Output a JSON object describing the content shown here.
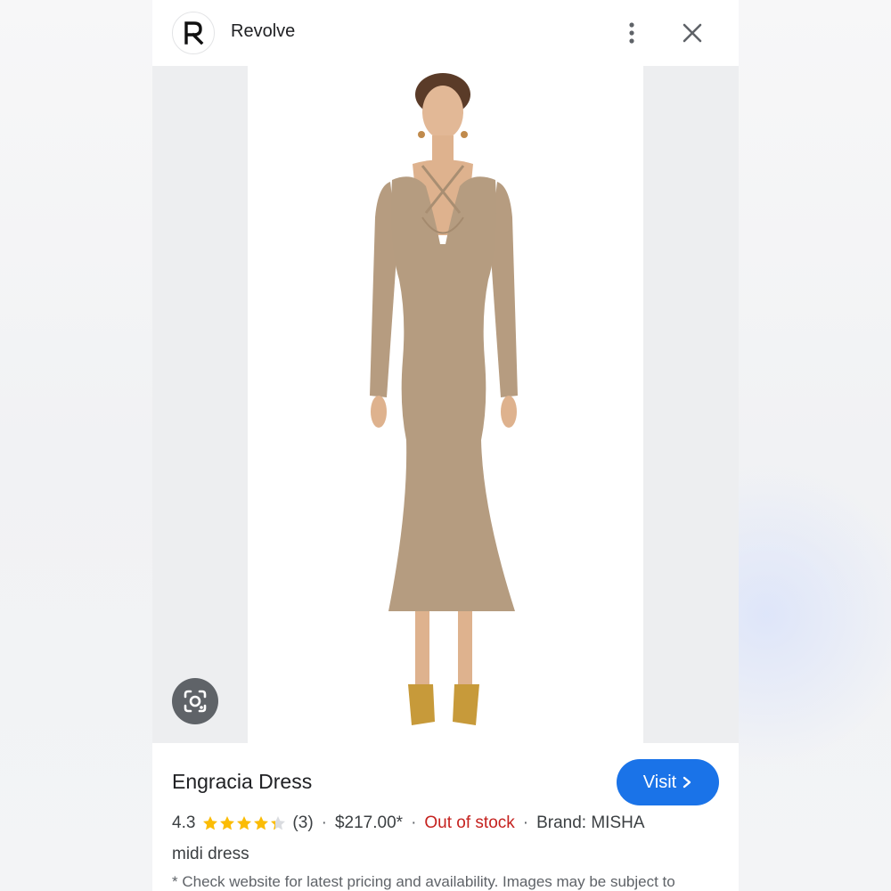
{
  "header": {
    "logo_letter": "R",
    "site_name": "Revolve"
  },
  "product": {
    "title": "Engracia Dress",
    "visit_label": "Visit",
    "rating": "4.3",
    "rating_value": 4.3,
    "rating_max": 5,
    "review_count": "(3)",
    "price": "$217.00*",
    "availability": "Out of stock",
    "brand": "Brand: MISHA",
    "category": "midi dress",
    "disclaimer": "* Check website for latest pricing and availability. Images may be subject to"
  },
  "image": {
    "subject": "model in long-sleeve taupe midi dress with gold heeled sandals"
  },
  "icons": {
    "more": "more-vert-icon",
    "close": "close-icon",
    "lens": "google-lens-icon",
    "visit_arrow": "chevron-right-icon"
  },
  "colors": {
    "accent": "#1a73e8",
    "out_of_stock": "#c5221f",
    "star": "#fbbc04",
    "star_empty": "#dadce0",
    "dress": "#b59c80"
  }
}
